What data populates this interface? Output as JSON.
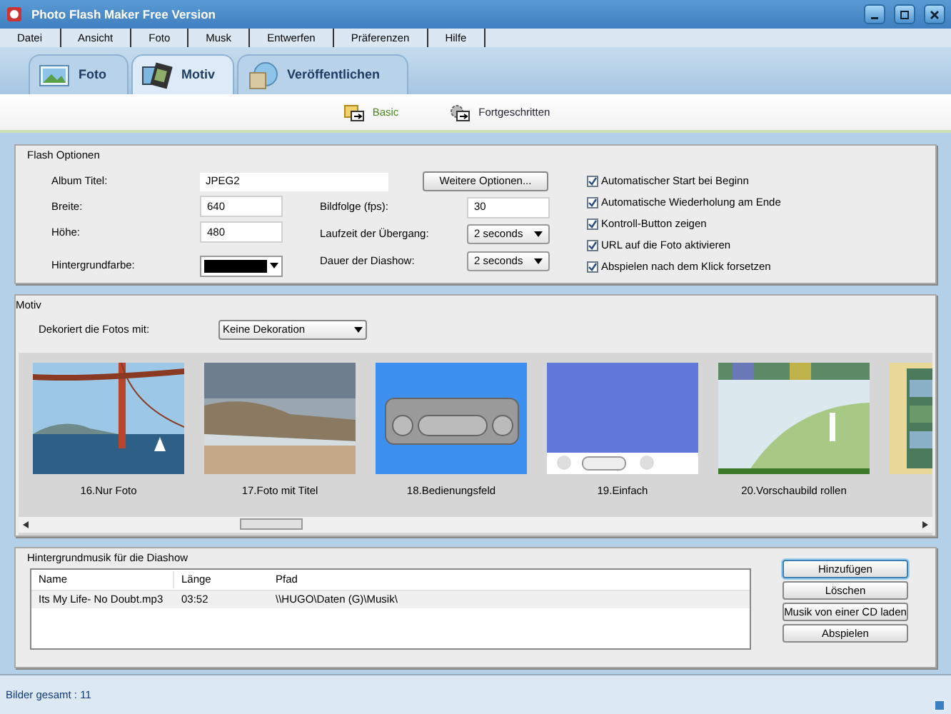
{
  "window": {
    "title": "Photo Flash Maker Free Version"
  },
  "menu": [
    "Datei",
    "Ansicht",
    "Foto",
    "Musk",
    "Entwerfen",
    "Präferenzen",
    "Hilfe"
  ],
  "tabs": [
    {
      "label": "Foto",
      "selected": false
    },
    {
      "label": "Motiv",
      "selected": true,
      "kind": "film"
    },
    {
      "label": "Veröffentlichen",
      "selected": false,
      "kind": "disc"
    }
  ],
  "subtabs": [
    {
      "label": "Basic",
      "selected": true,
      "kind": "basic"
    },
    {
      "label": "Fortgeschritten",
      "selected": false,
      "kind": "advanced"
    }
  ],
  "flash_options": {
    "title": "Flash Optionen",
    "album": {
      "label": "Album Titel:",
      "value": "JPEG2"
    },
    "more_button": "Weitere Optionen...",
    "left_fields": [
      {
        "label": "Breite:",
        "value": "640",
        "kind": "text"
      },
      {
        "label": "Höhe:",
        "value": "480",
        "kind": "text"
      },
      {
        "label": "Hintergrundfarbe:",
        "kind": "color",
        "color": "#000000"
      }
    ],
    "middle_fields": [
      {
        "label": "Bildfolge (fps):",
        "value": "30",
        "kind": "text"
      },
      {
        "label": "Laufzeit der Übergang:",
        "value": "2 seconds",
        "kind": "select"
      },
      {
        "label": "Dauer der Diashow:",
        "value": "2 seconds",
        "kind": "select"
      }
    ],
    "checkboxes": [
      {
        "label": "Automatischer Start bei Beginn",
        "checked": true
      },
      {
        "label": "Automatische Wiederholung am Ende",
        "checked": true
      },
      {
        "label": "Kontroll-Button zeigen",
        "checked": true
      },
      {
        "label": "URL auf die Foto aktivieren",
        "checked": true
      },
      {
        "label": "Abspielen nach dem Klick forsetzen",
        "checked": true
      }
    ]
  },
  "motiv": {
    "title": "Motiv",
    "decorate_label": "Dekoriert die Fotos mit:",
    "decorate_value": "Keine Dekoration",
    "thumbnails": [
      {
        "kind": "bridge",
        "caption": "16.Nur Foto"
      },
      {
        "kind": "beach",
        "caption": "17.Foto mit Titel"
      },
      {
        "kind": "panel",
        "caption": "18.Bedienungsfeld"
      },
      {
        "kind": "plain",
        "caption": "19.Einfach"
      },
      {
        "kind": "golf",
        "caption": "20.Vorschaubild rollen"
      },
      {
        "kind": "strip"
      }
    ]
  },
  "music": {
    "title": "Hintergrundmusik für die Diashow",
    "columns": [
      "Name",
      "Länge",
      "Pfad"
    ],
    "rows": [
      [
        "Its My Life- No Doubt.mp3",
        "03:52",
        "\\\\HUGO\\Daten (G)\\Musik\\"
      ]
    ],
    "buttons": [
      {
        "label": "Hinzufügen",
        "focused": true
      },
      {
        "label": "Löschen",
        "focused": false
      },
      {
        "label": "Musik von einer CD laden",
        "focused": false
      },
      {
        "label": "Abspielen",
        "focused": false
      }
    ]
  },
  "status_bar": "Bilder gesamt : 11"
}
